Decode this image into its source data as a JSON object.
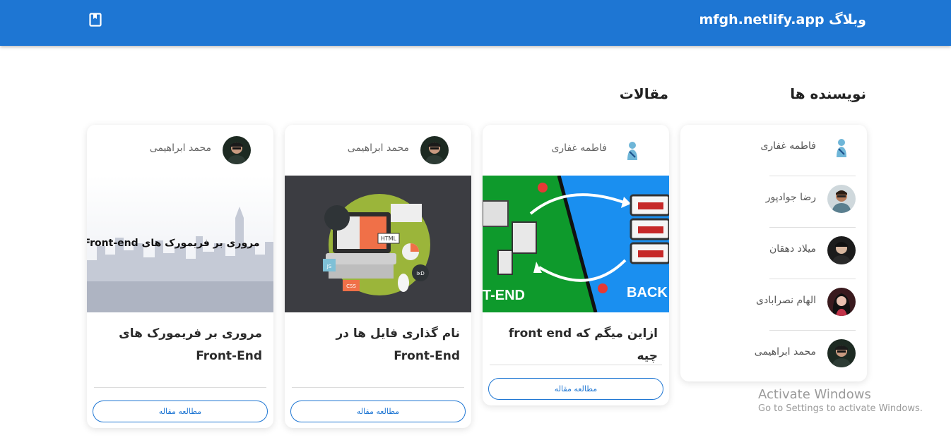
{
  "header": {
    "title": "وبلاگ mfgh.netlify.app",
    "icon": "bookmark-book-icon",
    "color": "#1e76d3"
  },
  "authors": {
    "title": "نویسنده ها",
    "items": [
      {
        "name": "فاطمه غفاری",
        "avatar": "woman-illustration-avatar"
      },
      {
        "name": "رضا جوادپور",
        "avatar": "man-photo-avatar"
      },
      {
        "name": "میلاد دهقان",
        "avatar": "man-photo-avatar"
      },
      {
        "name": "الهام نصرابادی",
        "avatar": "woman-photo-avatar"
      },
      {
        "name": "محمد ابراهیمی",
        "avatar": "man-photo-avatar"
      }
    ]
  },
  "articles": {
    "title": "مقالات",
    "items": [
      {
        "author": "فاطمه غفاری",
        "title": "ازاین میگم که front end چیه",
        "button": "مطالعه مقاله",
        "image_label_left": "T-END",
        "image_label_right": "BACK"
      },
      {
        "author": "محمد ابراهیمی",
        "title": "نام گذاری فایل ها در Front-End",
        "button": "مطالعه مقاله",
        "image_tags": [
          "HTML",
          "JS",
          "CSS",
          "IxD"
        ]
      },
      {
        "author": "محمد ابراهیمی",
        "title": "مروری بر فریمورک های Front-End",
        "button": "مطالعه مقاله",
        "image_caption": "مروری بر فریمورک های Front-end"
      }
    ]
  },
  "watermark": {
    "line1": "Activate Windows",
    "line2": "Go to Settings to activate Windows."
  }
}
